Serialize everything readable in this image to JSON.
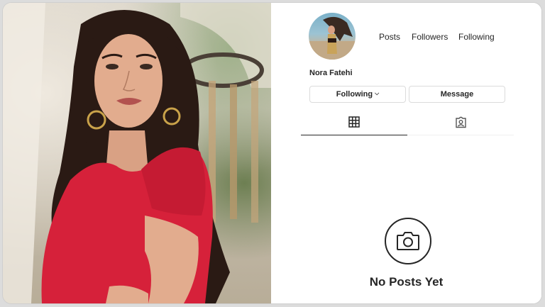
{
  "profile": {
    "name": "Nora Fatehi",
    "stats": {
      "posts_label": "Posts",
      "followers_label": "Followers",
      "following_label": "Following"
    },
    "buttons": {
      "following_label": "Following",
      "message_label": "Message"
    },
    "tabs": [
      {
        "icon": "grid-icon",
        "active": true
      },
      {
        "icon": "tagged-icon",
        "active": false
      }
    ],
    "empty_state": {
      "icon": "camera-icon",
      "title": "No Posts Yet"
    }
  },
  "colors": {
    "text": "#262626",
    "border": "#dbdbdb",
    "dress_red": "#d6213a"
  }
}
